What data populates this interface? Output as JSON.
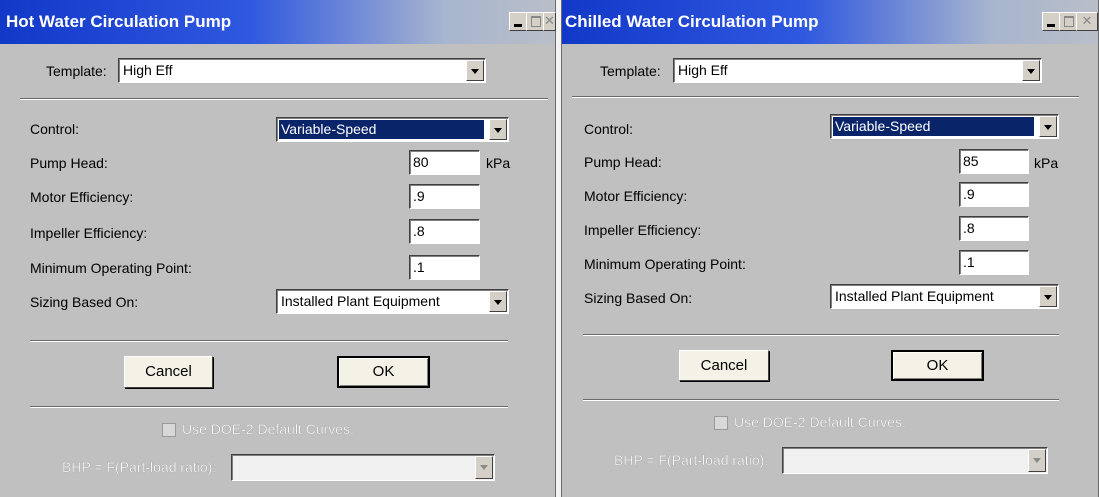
{
  "dialogs": [
    {
      "title": "Hot Water Circulation Pump",
      "template_label": "Template:",
      "template_value": "High Eff",
      "control_label": "Control:",
      "control_value": "Variable-Speed",
      "pump_head_label": "Pump Head:",
      "pump_head_value": "80",
      "pump_head_unit": "kPa",
      "motor_eff_label": "Motor Efficiency:",
      "motor_eff_value": ".9",
      "impeller_eff_label": "Impeller Efficiency:",
      "impeller_eff_value": ".8",
      "min_op_label": "Minimum Operating Point:",
      "min_op_value": ".1",
      "sizing_label": "Sizing Based On:",
      "sizing_value": "Installed Plant Equipment",
      "cancel_label": "Cancel",
      "ok_label": "OK",
      "use_default_label": "Use DOE-2 Default Curves.",
      "bhp_label": "BHP = F(Part-load ratio):",
      "bhp_value": ""
    },
    {
      "title": "Chilled Water Circulation Pump",
      "template_label": "Template:",
      "template_value": "High Eff",
      "control_label": "Control:",
      "control_value": "Variable-Speed",
      "pump_head_label": "Pump Head:",
      "pump_head_value": "85",
      "pump_head_unit": "kPa",
      "motor_eff_label": "Motor Efficiency:",
      "motor_eff_value": ".9",
      "impeller_eff_label": "Impeller Efficiency:",
      "impeller_eff_value": ".8",
      "min_op_label": "Minimum Operating Point:",
      "min_op_value": ".1",
      "sizing_label": "Sizing Based On:",
      "sizing_value": "Installed Plant Equipment",
      "cancel_label": "Cancel",
      "ok_label": "OK",
      "use_default_label": "Use DOE-2 Default Curves.",
      "bhp_label": "BHP = F(Part-load ratio):",
      "bhp_value": ""
    }
  ],
  "colors": {
    "titlebar_active": "#1238c8",
    "dialog_bg": "#c0c0c0",
    "selection": "#0a246a"
  }
}
